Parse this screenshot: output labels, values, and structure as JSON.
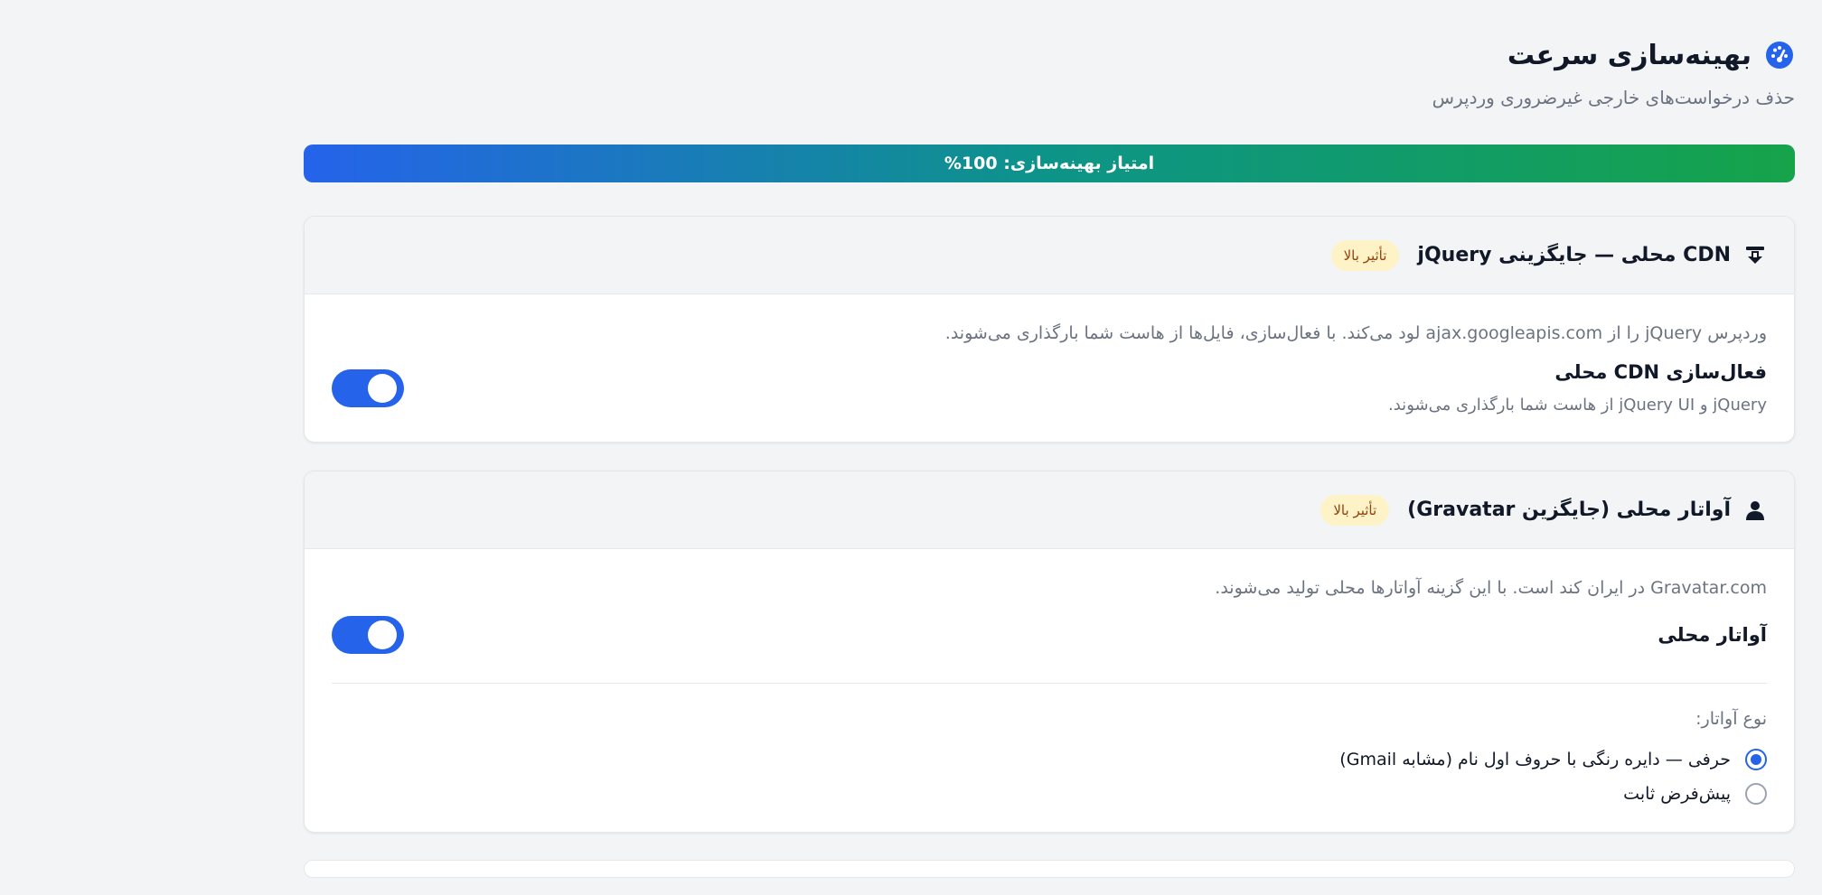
{
  "header": {
    "title": "بهینه‌سازی سرعت",
    "subtitle": "حذف درخواست‌های خارجی غیرضروری وردپرس",
    "icon": "gauge-icon"
  },
  "score": {
    "label": "امتیاز بهینه‌سازی: 100%",
    "percent": 100
  },
  "cards": [
    {
      "icon": "download-icon",
      "title": "CDN محلی — جایگزینی jQuery",
      "badge": "تأثیر بالا",
      "description": "وردپرس jQuery را از ajax.googleapis.com لود می‌کند. با فعال‌سازی، فایل‌ها از هاست شما بارگذاری می‌شوند.",
      "setting_label": "فعال‌سازی CDN محلی",
      "setting_help": "jQuery و jQuery UI از هاست شما بارگذاری می‌شوند.",
      "toggle_on": true
    },
    {
      "icon": "user-icon",
      "title": "آواتار محلی (جایگزین Gravatar)",
      "badge": "تأثیر بالا",
      "description": "Gravatar.com در ایران کند است. با این گزینه آواتارها محلی تولید می‌شوند.",
      "setting_label": "آواتار محلی",
      "toggle_on": true,
      "radio_title": "نوع آواتار:",
      "options": [
        {
          "label": "حرفی — دایره رنگی با حروف اول نام (مشابه Gmail)",
          "selected": true
        },
        {
          "label": "پیش‌فرض ثابت",
          "selected": false
        }
      ]
    }
  ],
  "colors": {
    "accent": "#2563eb",
    "gradient_end": "#16a34a",
    "badge_bg": "#fef3c7",
    "badge_text": "#92400e"
  }
}
